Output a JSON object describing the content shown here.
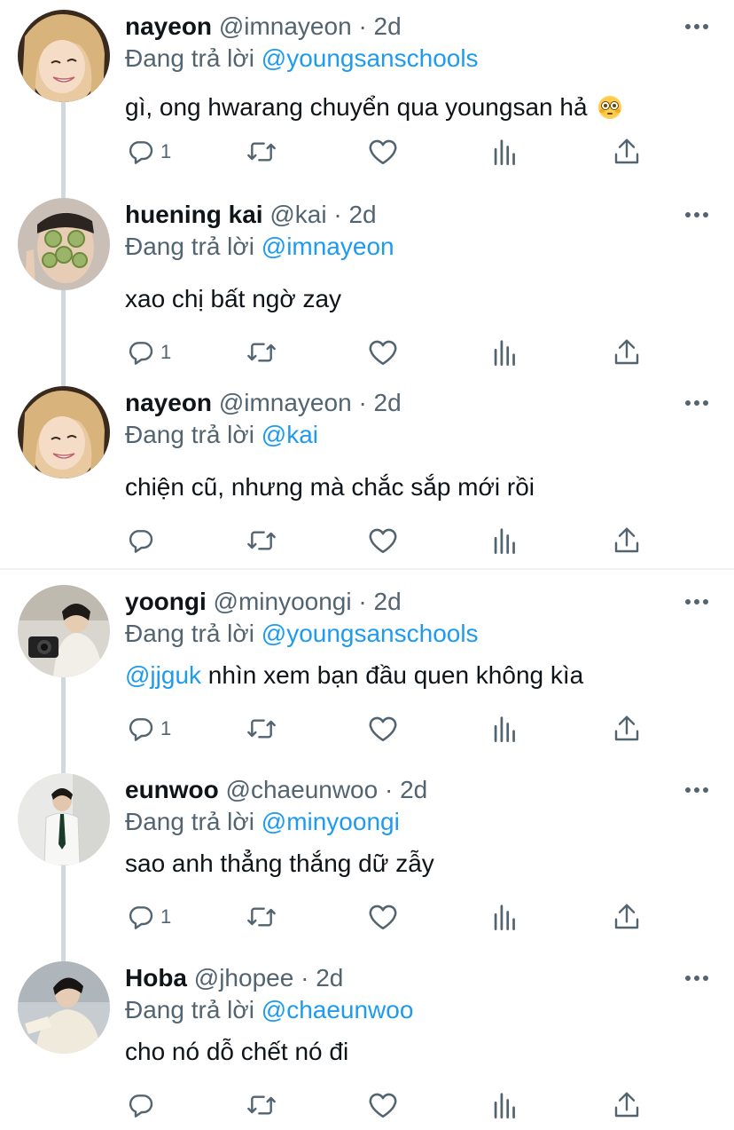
{
  "tweets": [
    {
      "name": "nayeon",
      "handle": "@imnayeon",
      "time": "2d",
      "replying_label": "Đang trả lời",
      "replying_to": "@youngsanschools",
      "text": "gì, ong hwarang chuyển qua youngsan hả",
      "emoji": "flushed-face-emoji",
      "reply_count": "1",
      "avatar": "nayeon-avatar"
    },
    {
      "name": "huening kai",
      "handle": "@kai",
      "time": "2d",
      "replying_label": "Đang trả lời",
      "replying_to": "@imnayeon",
      "text": "xao chị bất ngờ zay",
      "reply_count": "1",
      "avatar": "kai-avatar"
    },
    {
      "name": "nayeon",
      "handle": "@imnayeon",
      "time": "2d",
      "replying_label": "Đang trả lời",
      "replying_to": "@kai",
      "text": "chiện cũ, nhưng mà chắc sắp mới rồi",
      "reply_count": "",
      "avatar": "nayeon-avatar"
    },
    {
      "name": "yoongi",
      "handle": "@minyoongi",
      "time": "2d",
      "replying_label": "Đang trả lời",
      "replying_to": "@youngsanschools",
      "text_mention": "@jjguk",
      "text": " nhìn xem bạn đầu quen không kìa",
      "reply_count": "1",
      "avatar": "yoongi-avatar"
    },
    {
      "name": "eunwoo",
      "handle": "@chaeunwoo",
      "time": "2d",
      "replying_label": "Đang trả lời",
      "replying_to": "@minyoongi",
      "text": "sao anh thẳng thắng dữ zẫy",
      "reply_count": "1",
      "avatar": "eunwoo-avatar"
    },
    {
      "name": "Hoba",
      "handle": "@jhopee",
      "time": "2d",
      "replying_label": "Đang trả lời",
      "replying_to": "@chaeunwoo",
      "text": "cho nó dỗ chết nó đi",
      "reply_count": "",
      "avatar": "hoba-avatar"
    }
  ],
  "separator": "·",
  "icons": {
    "reply": "reply-icon",
    "retweet": "retweet-icon",
    "like": "like-icon",
    "views": "views-icon",
    "share": "share-icon",
    "more": "more-icon"
  },
  "colors": {
    "accent": "#1d9bf0",
    "muted": "#536471",
    "thread_line": "#cfd9de"
  }
}
